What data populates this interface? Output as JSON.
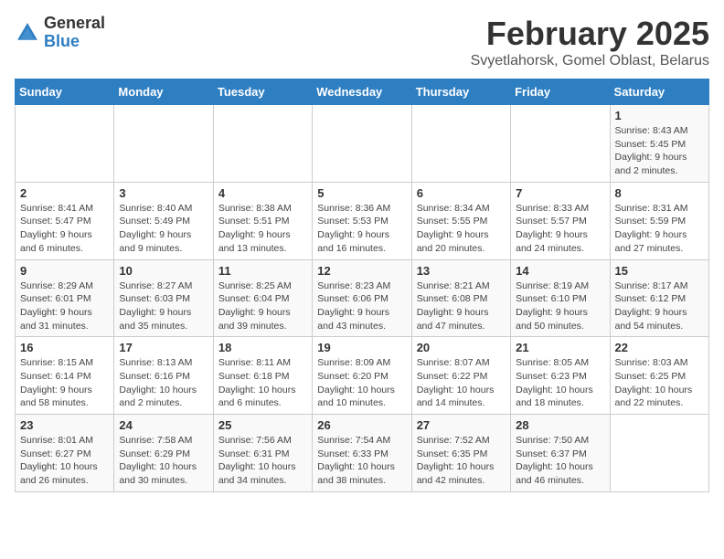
{
  "header": {
    "logo": {
      "general": "General",
      "blue": "Blue"
    },
    "title": "February 2025",
    "subtitle": "Svyetlahorsk, Gomel Oblast, Belarus"
  },
  "calendar": {
    "weekdays": [
      "Sunday",
      "Monday",
      "Tuesday",
      "Wednesday",
      "Thursday",
      "Friday",
      "Saturday"
    ],
    "weeks": [
      [
        {
          "day": "",
          "info": ""
        },
        {
          "day": "",
          "info": ""
        },
        {
          "day": "",
          "info": ""
        },
        {
          "day": "",
          "info": ""
        },
        {
          "day": "",
          "info": ""
        },
        {
          "day": "",
          "info": ""
        },
        {
          "day": "1",
          "info": "Sunrise: 8:43 AM\nSunset: 5:45 PM\nDaylight: 9 hours and 2 minutes."
        }
      ],
      [
        {
          "day": "2",
          "info": "Sunrise: 8:41 AM\nSunset: 5:47 PM\nDaylight: 9 hours and 6 minutes."
        },
        {
          "day": "3",
          "info": "Sunrise: 8:40 AM\nSunset: 5:49 PM\nDaylight: 9 hours and 9 minutes."
        },
        {
          "day": "4",
          "info": "Sunrise: 8:38 AM\nSunset: 5:51 PM\nDaylight: 9 hours and 13 minutes."
        },
        {
          "day": "5",
          "info": "Sunrise: 8:36 AM\nSunset: 5:53 PM\nDaylight: 9 hours and 16 minutes."
        },
        {
          "day": "6",
          "info": "Sunrise: 8:34 AM\nSunset: 5:55 PM\nDaylight: 9 hours and 20 minutes."
        },
        {
          "day": "7",
          "info": "Sunrise: 8:33 AM\nSunset: 5:57 PM\nDaylight: 9 hours and 24 minutes."
        },
        {
          "day": "8",
          "info": "Sunrise: 8:31 AM\nSunset: 5:59 PM\nDaylight: 9 hours and 27 minutes."
        }
      ],
      [
        {
          "day": "9",
          "info": "Sunrise: 8:29 AM\nSunset: 6:01 PM\nDaylight: 9 hours and 31 minutes."
        },
        {
          "day": "10",
          "info": "Sunrise: 8:27 AM\nSunset: 6:03 PM\nDaylight: 9 hours and 35 minutes."
        },
        {
          "day": "11",
          "info": "Sunrise: 8:25 AM\nSunset: 6:04 PM\nDaylight: 9 hours and 39 minutes."
        },
        {
          "day": "12",
          "info": "Sunrise: 8:23 AM\nSunset: 6:06 PM\nDaylight: 9 hours and 43 minutes."
        },
        {
          "day": "13",
          "info": "Sunrise: 8:21 AM\nSunset: 6:08 PM\nDaylight: 9 hours and 47 minutes."
        },
        {
          "day": "14",
          "info": "Sunrise: 8:19 AM\nSunset: 6:10 PM\nDaylight: 9 hours and 50 minutes."
        },
        {
          "day": "15",
          "info": "Sunrise: 8:17 AM\nSunset: 6:12 PM\nDaylight: 9 hours and 54 minutes."
        }
      ],
      [
        {
          "day": "16",
          "info": "Sunrise: 8:15 AM\nSunset: 6:14 PM\nDaylight: 9 hours and 58 minutes."
        },
        {
          "day": "17",
          "info": "Sunrise: 8:13 AM\nSunset: 6:16 PM\nDaylight: 10 hours and 2 minutes."
        },
        {
          "day": "18",
          "info": "Sunrise: 8:11 AM\nSunset: 6:18 PM\nDaylight: 10 hours and 6 minutes."
        },
        {
          "day": "19",
          "info": "Sunrise: 8:09 AM\nSunset: 6:20 PM\nDaylight: 10 hours and 10 minutes."
        },
        {
          "day": "20",
          "info": "Sunrise: 8:07 AM\nSunset: 6:22 PM\nDaylight: 10 hours and 14 minutes."
        },
        {
          "day": "21",
          "info": "Sunrise: 8:05 AM\nSunset: 6:23 PM\nDaylight: 10 hours and 18 minutes."
        },
        {
          "day": "22",
          "info": "Sunrise: 8:03 AM\nSunset: 6:25 PM\nDaylight: 10 hours and 22 minutes."
        }
      ],
      [
        {
          "day": "23",
          "info": "Sunrise: 8:01 AM\nSunset: 6:27 PM\nDaylight: 10 hours and 26 minutes."
        },
        {
          "day": "24",
          "info": "Sunrise: 7:58 AM\nSunset: 6:29 PM\nDaylight: 10 hours and 30 minutes."
        },
        {
          "day": "25",
          "info": "Sunrise: 7:56 AM\nSunset: 6:31 PM\nDaylight: 10 hours and 34 minutes."
        },
        {
          "day": "26",
          "info": "Sunrise: 7:54 AM\nSunset: 6:33 PM\nDaylight: 10 hours and 38 minutes."
        },
        {
          "day": "27",
          "info": "Sunrise: 7:52 AM\nSunset: 6:35 PM\nDaylight: 10 hours and 42 minutes."
        },
        {
          "day": "28",
          "info": "Sunrise: 7:50 AM\nSunset: 6:37 PM\nDaylight: 10 hours and 46 minutes."
        },
        {
          "day": "",
          "info": ""
        }
      ]
    ]
  }
}
